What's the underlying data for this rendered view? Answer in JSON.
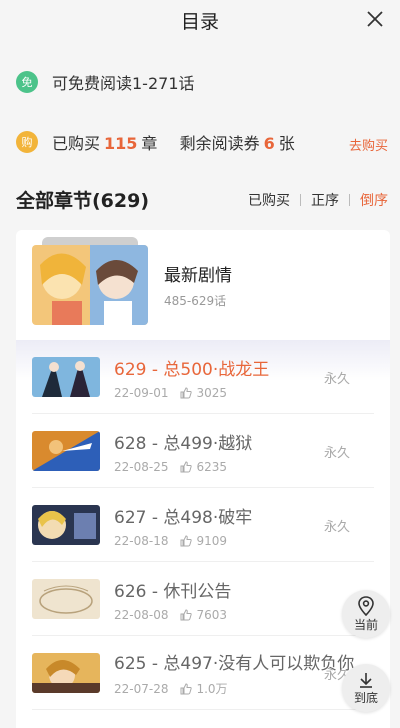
{
  "header": {
    "title": "目录"
  },
  "free_info": {
    "badge": "免",
    "text": "可免费阅读1-271话"
  },
  "purchase_info": {
    "badge": "购",
    "prefix": "已购买",
    "bought_count": "115",
    "bought_unit": "章",
    "ticket_prefix": "剩余阅读券",
    "ticket_count": "6",
    "ticket_unit": "张",
    "buy_link": "去购买"
  },
  "section": {
    "label": "全部章节(629)",
    "filters": {
      "bought": "已购买",
      "asc": "正序",
      "desc": "倒序"
    }
  },
  "latest": {
    "title": "最新剧情",
    "range": "485-629话"
  },
  "chapters": [
    {
      "title": "629 - 总500·战龙王",
      "date": "22-09-01",
      "likes": "3025",
      "status": "永久"
    },
    {
      "title": "628 - 总499·越狱",
      "date": "22-08-25",
      "likes": "6235",
      "status": "永久"
    },
    {
      "title": "627 - 总498·破牢",
      "date": "22-08-18",
      "likes": "9109",
      "status": "永久"
    },
    {
      "title": "626 - 休刊公告",
      "date": "22-08-08",
      "likes": "7603",
      "status": ""
    },
    {
      "title": "625 - 总497·没有人可以欺负你",
      "date": "22-07-28",
      "likes": "1.0万",
      "status": "永久"
    }
  ],
  "floating": {
    "current": "当前",
    "bottom": "到底"
  },
  "colors": {
    "accent": "#e8663a",
    "free_badge": "#4cc38a",
    "buy_badge": "#f2b43a"
  }
}
